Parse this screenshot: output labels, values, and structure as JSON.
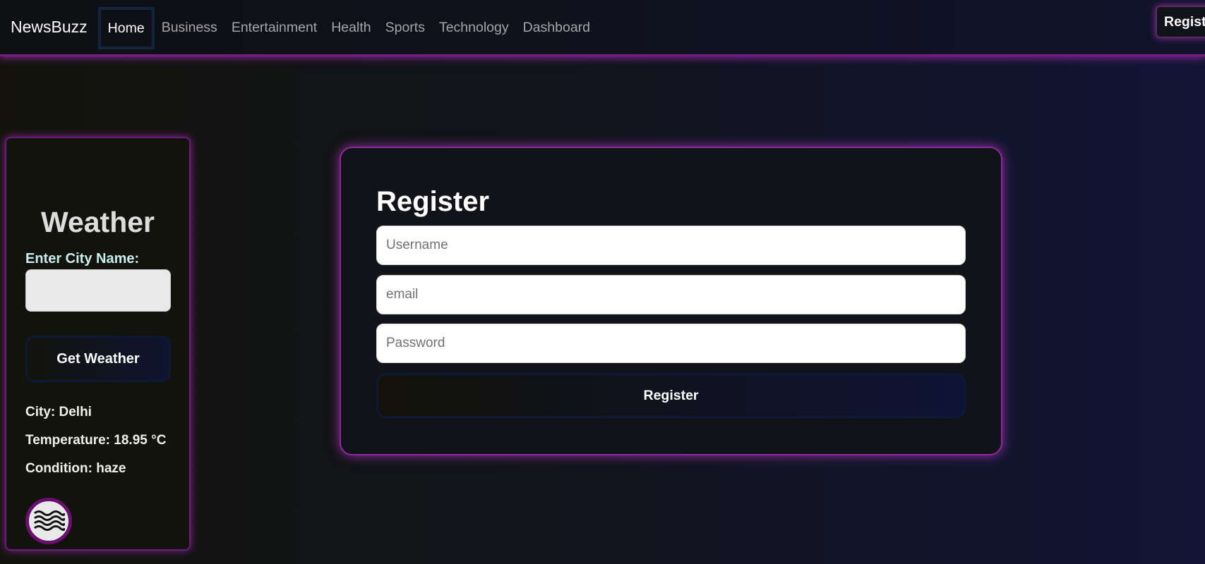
{
  "navbar": {
    "brand": "NewsBuzz",
    "links": [
      {
        "label": "Home",
        "active": true
      },
      {
        "label": "Business",
        "active": false
      },
      {
        "label": "Entertainment",
        "active": false
      },
      {
        "label": "Health",
        "active": false
      },
      {
        "label": "Sports",
        "active": false
      },
      {
        "label": "Technology",
        "active": false
      },
      {
        "label": "Dashboard",
        "active": false
      }
    ],
    "register_label": "Register"
  },
  "weather": {
    "title": "Weather",
    "city_label": "Enter City Name:",
    "city_value": "",
    "button_label": "Get Weather",
    "city_line": "City: Delhi",
    "temperature_line": "Temperature: 18.95 °C",
    "condition_line": "Condition: haze",
    "condition_icon": "haze-icon"
  },
  "register_form": {
    "title": "Register",
    "username_placeholder": "Username",
    "email_placeholder": "email",
    "password_placeholder": "Password",
    "submit_label": "Register"
  },
  "colors": {
    "accent_glow": "#8a2a9c",
    "navbar_active_border": "#14253d",
    "nav_link": "#a6a6a6"
  }
}
